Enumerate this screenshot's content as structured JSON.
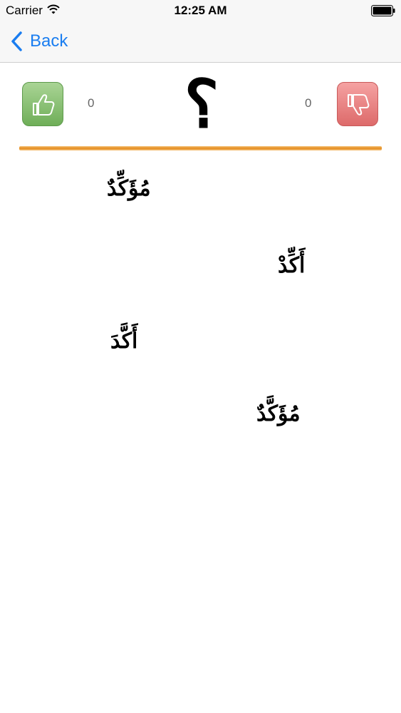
{
  "status_bar": {
    "carrier": "Carrier",
    "time": "12:25 AM"
  },
  "nav": {
    "back_label": "Back"
  },
  "score": {
    "correct_count": "0",
    "wrong_count": "0",
    "question_symbol": "؟"
  },
  "colors": {
    "accent": "#1a7df0",
    "correct_green": "#6fae58",
    "wrong_red": "#dd6a6a",
    "divider_orange": "#e48a1c"
  },
  "words": [
    "مُؤَكِّدٌ",
    "أَكِّدْ",
    "أَكَّدَ",
    "مُؤَكَّدٌ"
  ]
}
